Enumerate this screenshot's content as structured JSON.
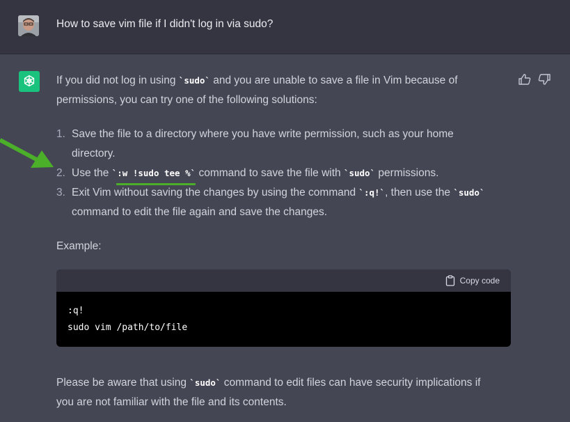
{
  "user_message": {
    "text": "How to save vim file if I didn't log in via sudo?"
  },
  "assistant": {
    "intro_line1_a": "If you did not log in using ",
    "intro_code1": "`sudo`",
    "intro_line1_b": " and you are unable to save a file in Vim because of",
    "intro_line2": "permissions, you can try one of the following solutions:",
    "list": [
      {
        "number": "1.",
        "line1": "Save the file to a directory where you have write permission, such as your home",
        "line2": "directory."
      },
      {
        "number": "2.",
        "pre": "Use the ",
        "code": "`:w !sudo tee %`",
        "mid": " command to save the file with ",
        "code2": "`sudo`",
        "post": " permissions."
      },
      {
        "number": "3.",
        "pre": "Exit Vim without saving the changes by using the command ",
        "code": "`:q!`",
        "mid": ", then use the ",
        "code2": "`sudo`",
        "line2": "command to edit the file again and save the changes."
      }
    ],
    "example_label": "Example:",
    "code_block": {
      "copy_label": "Copy code",
      "lines": [
        ":q!",
        "sudo vim /path/to/file"
      ]
    },
    "outro_a": "Please be aware that using ",
    "outro_code": "`sudo`",
    "outro_b": " command to edit files can have security implications if",
    "outro_line2": "you are not familiar with the file and its contents."
  },
  "icons": {
    "assistant_logo": "openai-logo-icon",
    "thumbs_up": "thumbs-up-icon",
    "thumbs_down": "thumbs-down-icon",
    "copy": "clipboard-icon",
    "annotation_arrow": "arrow-icon"
  },
  "colors": {
    "user_bg": "#343541",
    "assistant_bg": "#444654",
    "logo_bg": "#19c37d",
    "annotation_green": "#4caf2a"
  }
}
